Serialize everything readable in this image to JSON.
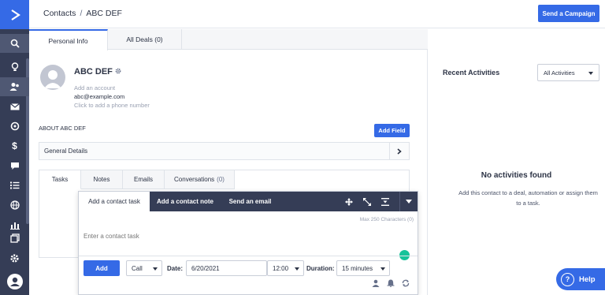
{
  "breadcrumb": {
    "section": "Contacts",
    "separator": "/",
    "current": "ABC DEF"
  },
  "header": {
    "campaign_button": "Send a Campaign"
  },
  "tabs": [
    {
      "label": "Personal Info"
    },
    {
      "label": "All Deals (0)"
    }
  ],
  "contact": {
    "name": "ABC DEF",
    "account": "Add an account",
    "email": "abc@example.com",
    "phone": "Click to add a phone number"
  },
  "about": {
    "title": "ABOUT ABC DEF",
    "add_field": "Add Field",
    "general_details": "General Details"
  },
  "subtabs": [
    {
      "label": "Tasks"
    },
    {
      "label": "Notes"
    },
    {
      "label": "Emails"
    },
    {
      "label": "Conversations",
      "count": "(0)"
    }
  ],
  "composer": {
    "tabs": [
      {
        "label": "Add a contact task"
      },
      {
        "label": "Add a contact note"
      },
      {
        "label": "Send an email"
      }
    ],
    "max_chars": "Max 250 Characters (0)",
    "placeholder": "Enter a contact task",
    "add_button": "Add",
    "type_value": "Call",
    "date_label": "Date:",
    "date_value": "6/20/2021",
    "time_value": "12:00",
    "duration_label": "Duration:",
    "duration_value": "15 minutes"
  },
  "activities": {
    "title": "Recent Activities",
    "filter": "All Activities",
    "empty_title": "No activities found",
    "empty_text": "Add this contact to a deal, automation or assign them to a task."
  },
  "help": {
    "label": "Help",
    "glyph": "?"
  },
  "colors": {
    "accent": "#356ae6",
    "sidebar": "#353d56"
  },
  "sidebar_icons": [
    "logo-icon",
    "search-icon",
    "lightbulb-icon",
    "contacts-icon",
    "mail-icon",
    "automation-icon",
    "dollar-icon",
    "chat-icon",
    "list-icon",
    "globe-icon",
    "reports-icon",
    "pages-icon",
    "settings-icon",
    "user-avatar-icon"
  ]
}
